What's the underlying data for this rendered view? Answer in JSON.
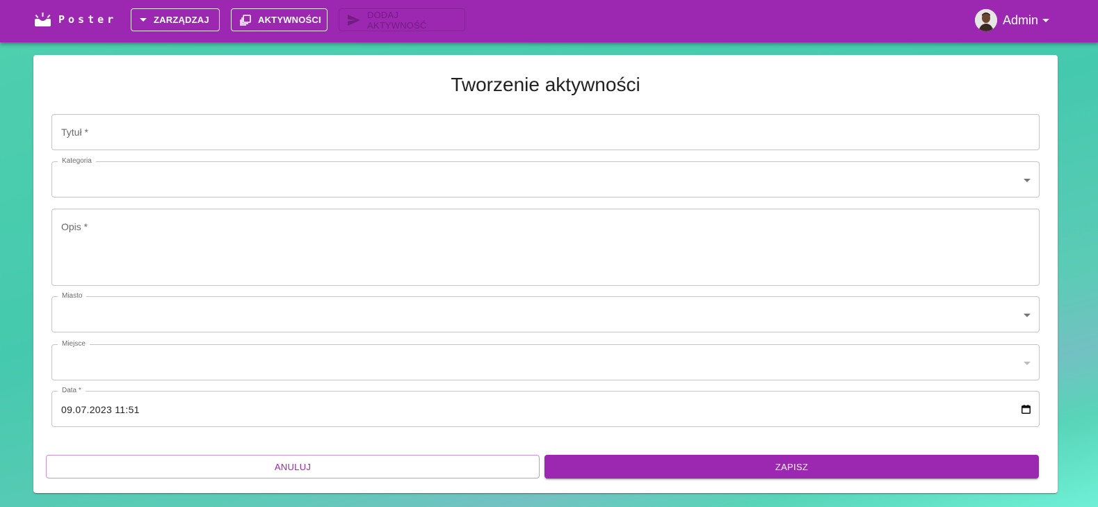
{
  "app": {
    "name": "Poster"
  },
  "nav": {
    "manage_label": "ZARZĄDZAJ",
    "activities_label": "AKTYWNOŚCI",
    "add_activity_label": "DODAJ AKTYWNOŚĆ"
  },
  "user": {
    "name": "Admin"
  },
  "page": {
    "title": "Tworzenie aktywności"
  },
  "form": {
    "title_placeholder": "Tytuł *",
    "category_label": "Kategoria",
    "category_value": "",
    "description_placeholder": "Opis *",
    "city_label": "Miasto",
    "city_value": "",
    "place_label": "Miejsce",
    "place_value": "",
    "date_label": "Data *",
    "date_value": "09.07.2023 11:51"
  },
  "actions": {
    "cancel_label": "ANULUJ",
    "save_label": "ZAPISZ"
  },
  "colors": {
    "primary": "#9c27b0",
    "background_accent": "#4fd0ae"
  },
  "icons": {
    "logo": "box-with-rays-icon",
    "manage": "caret-down-icon",
    "activities": "library-stack-icon",
    "add_activity": "send-icon",
    "user_menu": "caret-down-icon",
    "date": "calendar-icon"
  }
}
